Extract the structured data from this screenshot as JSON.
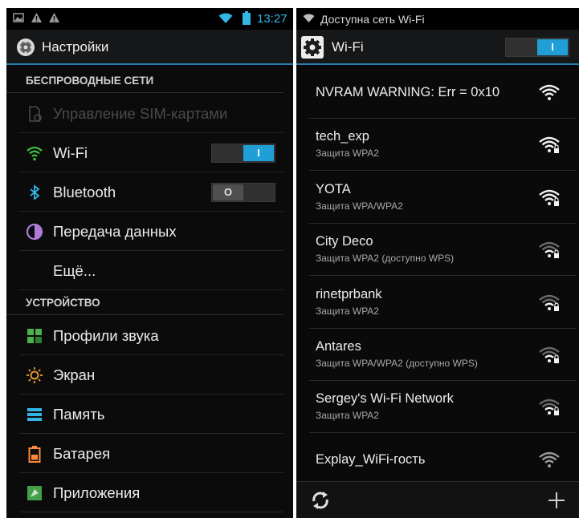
{
  "left": {
    "status_bar": {
      "time": "13:27",
      "icons": [
        "image-icon",
        "warning-icon",
        "warning-icon",
        "wifi-icon",
        "battery-icon"
      ]
    },
    "action_bar": {
      "title": "Настройки",
      "icon": "settings-icon"
    },
    "sections": [
      {
        "header": "БЕСПРОВОДНЫЕ СЕТИ",
        "items": [
          {
            "label": "Управление SIM-картами",
            "icon": "sim-card-icon",
            "disabled": true
          },
          {
            "label": "Wi-Fi",
            "icon": "wifi-icon",
            "toggle": "on",
            "toggle_label": "I"
          },
          {
            "label": "Bluetooth",
            "icon": "bluetooth-icon",
            "toggle": "off",
            "toggle_label": "O"
          },
          {
            "label": "Передача данных",
            "icon": "data-usage-icon"
          },
          {
            "label": "Ещё...",
            "icon": ""
          }
        ]
      },
      {
        "header": "УСТРОЙСТВО",
        "items": [
          {
            "label": "Профили звука",
            "icon": "sound-profiles-icon"
          },
          {
            "label": "Экран",
            "icon": "display-icon"
          },
          {
            "label": "Память",
            "icon": "storage-icon"
          },
          {
            "label": "Батарея",
            "icon": "battery-icon"
          },
          {
            "label": "Приложения",
            "icon": "apps-icon"
          }
        ]
      }
    ]
  },
  "right": {
    "status_bar": {
      "notification": "Доступна сеть Wi-Fi",
      "icon": "wifi-icon"
    },
    "action_bar": {
      "title": "Wi-Fi",
      "icon": "settings-icon",
      "toggle": "on",
      "toggle_label": "I"
    },
    "networks": [
      {
        "ssid": "NVRAM WARNING: Err = 0x10",
        "security": "",
        "locked": false,
        "signal": "strong"
      },
      {
        "ssid": "tech_exp",
        "security": "Защита WPA2",
        "locked": true,
        "signal": "strong"
      },
      {
        "ssid": "YOTA",
        "security": "Защита WPA/WPA2",
        "locked": true,
        "signal": "strong"
      },
      {
        "ssid": "City Deco",
        "security": "Защита WPA2 (доступно WPS)",
        "locked": true,
        "signal": "medium"
      },
      {
        "ssid": "rinetprbank",
        "security": "Защита WPA2",
        "locked": true,
        "signal": "medium"
      },
      {
        "ssid": "Antares",
        "security": "Защита WPA/WPA2 (доступно WPS)",
        "locked": true,
        "signal": "medium"
      },
      {
        "ssid": "Sergey's Wi-Fi Network",
        "security": "Защита WPA2",
        "locked": true,
        "signal": "medium"
      },
      {
        "ssid": "Explay_WiFi-гость",
        "security": "",
        "locked": false,
        "signal": "weak"
      }
    ],
    "bottom_bar": {
      "left_icon": "refresh-icon",
      "right_icon": "add-network-icon"
    }
  },
  "colors": {
    "accent": "#33b5e5",
    "toggle_on": "#1f9fd6",
    "background": "#0b0b0b"
  }
}
